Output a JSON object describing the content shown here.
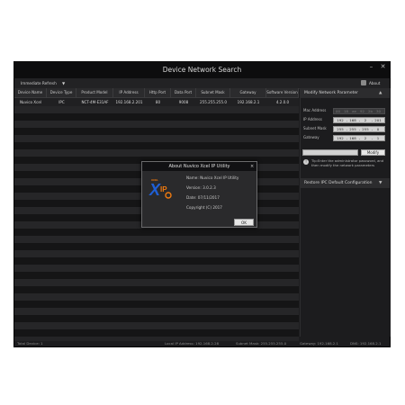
{
  "window": {
    "title": "Device Network Search"
  },
  "toolbar": {
    "refresh_label": "Immediate Refresh",
    "refresh_caret": "▼",
    "about_label": "About"
  },
  "table": {
    "columns": [
      "Device Name",
      "Device Type",
      "Product Model",
      "IP Address",
      "Http Port",
      "Data Port",
      "Subnet Mask",
      "Gateway",
      "Software Version"
    ],
    "rows": [
      [
        "Nuvico Xcel",
        "IPC",
        "NCT-4M-E31AF",
        "192.168.2.201",
        "80",
        "9008",
        "255.255.255.0",
        "192.168.2.1",
        "4.2.0.0"
      ]
    ]
  },
  "panel": {
    "modify_title": "Modify Network Parameter",
    "mac_label": "Mac Address",
    "ip_label": "IP Address",
    "subnet_label": "Subnet Mask",
    "gateway_label": "Gateway",
    "mac_value": [
      "00",
      "18",
      "ae",
      "92",
      "2b",
      "30"
    ],
    "ip_value": [
      "192",
      "168",
      "2",
      "201"
    ],
    "subnet_value": [
      "255",
      "255",
      "255",
      "0"
    ],
    "gateway_value": [
      "192",
      "168",
      "2",
      "1"
    ],
    "modify_button": "Modify",
    "tip_text": "Tip:Enter the administrator password, and then modify the network parameters",
    "restore_title": "Restore IPC Default Configuration",
    "caret": "▼"
  },
  "status": {
    "total": "Total Device: 1",
    "local_ip": "Local IP Address: 192.168.2.28",
    "subnet": "Subnet Mask: 255.255.255.0",
    "gateway": "Gateway: 192.168.2.1",
    "dns": "DNS: 192.168.2.1"
  },
  "dialog": {
    "title": "About Nuvico Xcel IP Utility",
    "name": "Name: Nuvico Xcel IP Utility",
    "version": "Version: 3.0.2.3",
    "date": "Date: 07/11/2017",
    "copyright": "Copyright (C) 2017",
    "ok_label": "OK",
    "close_glyph": "×",
    "logo_text": "XCEL",
    "logo_xp": "X",
    "logo_ip": "IP"
  },
  "colors": {
    "window_bg": "#1c1c1e",
    "logo_blue": "#1f5fd6",
    "logo_orange": "#f07a10"
  }
}
